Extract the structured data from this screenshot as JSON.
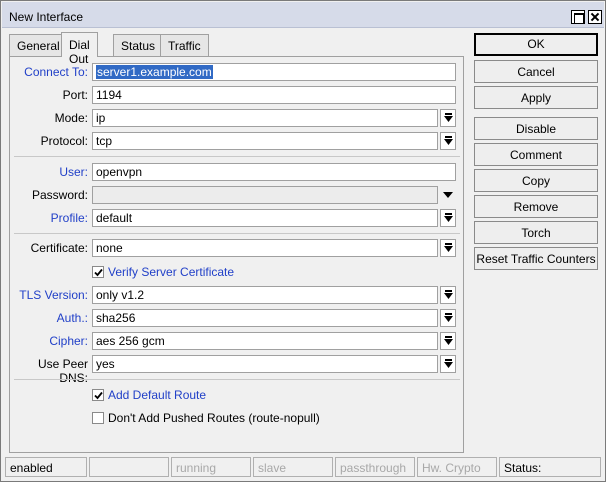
{
  "window": {
    "title": "New Interface"
  },
  "tabs": [
    {
      "label": "General",
      "active": false
    },
    {
      "label": "Dial Out",
      "active": true
    },
    {
      "label": "Status",
      "active": false
    },
    {
      "label": "Traffic",
      "active": false
    }
  ],
  "form": {
    "connect_to": {
      "label": "Connect To:",
      "value": "server1.example.com"
    },
    "port": {
      "label": "Port:",
      "value": "1194"
    },
    "mode": {
      "label": "Mode:",
      "value": "ip"
    },
    "protocol": {
      "label": "Protocol:",
      "value": "tcp"
    },
    "user": {
      "label": "User:",
      "value": "openvpn"
    },
    "password": {
      "label": "Password:",
      "value": ""
    },
    "profile": {
      "label": "Profile:",
      "value": "default"
    },
    "certificate": {
      "label": "Certificate:",
      "value": "none"
    },
    "verify_cert": {
      "label": "Verify Server Certificate",
      "checked": true
    },
    "tls_version": {
      "label": "TLS Version:",
      "value": "only v1.2"
    },
    "auth": {
      "label": "Auth.:",
      "value": "sha256"
    },
    "cipher": {
      "label": "Cipher:",
      "value": "aes 256 gcm"
    },
    "use_peer_dns": {
      "label": "Use Peer DNS:",
      "value": "yes"
    },
    "add_default_route": {
      "label": "Add Default Route",
      "checked": true
    },
    "dont_add_pushed_routes": {
      "label": "Don't Add Pushed Routes (route-nopull)",
      "checked": false
    }
  },
  "buttons": {
    "ok": "OK",
    "cancel": "Cancel",
    "apply": "Apply",
    "disable": "Disable",
    "comment": "Comment",
    "copy": "Copy",
    "remove": "Remove",
    "torch": "Torch",
    "reset_traffic": "Reset Traffic Counters"
  },
  "status_bar": {
    "enabled": "enabled",
    "blank": "",
    "running": "running",
    "slave": "slave",
    "passthrough": "passthrough",
    "hw_crypto": "Hw. Crypto",
    "status": "Status:"
  },
  "colors": {
    "label_link": "#2140c8",
    "selection": "#316ac5",
    "title_bar": "#d6dbe9"
  }
}
